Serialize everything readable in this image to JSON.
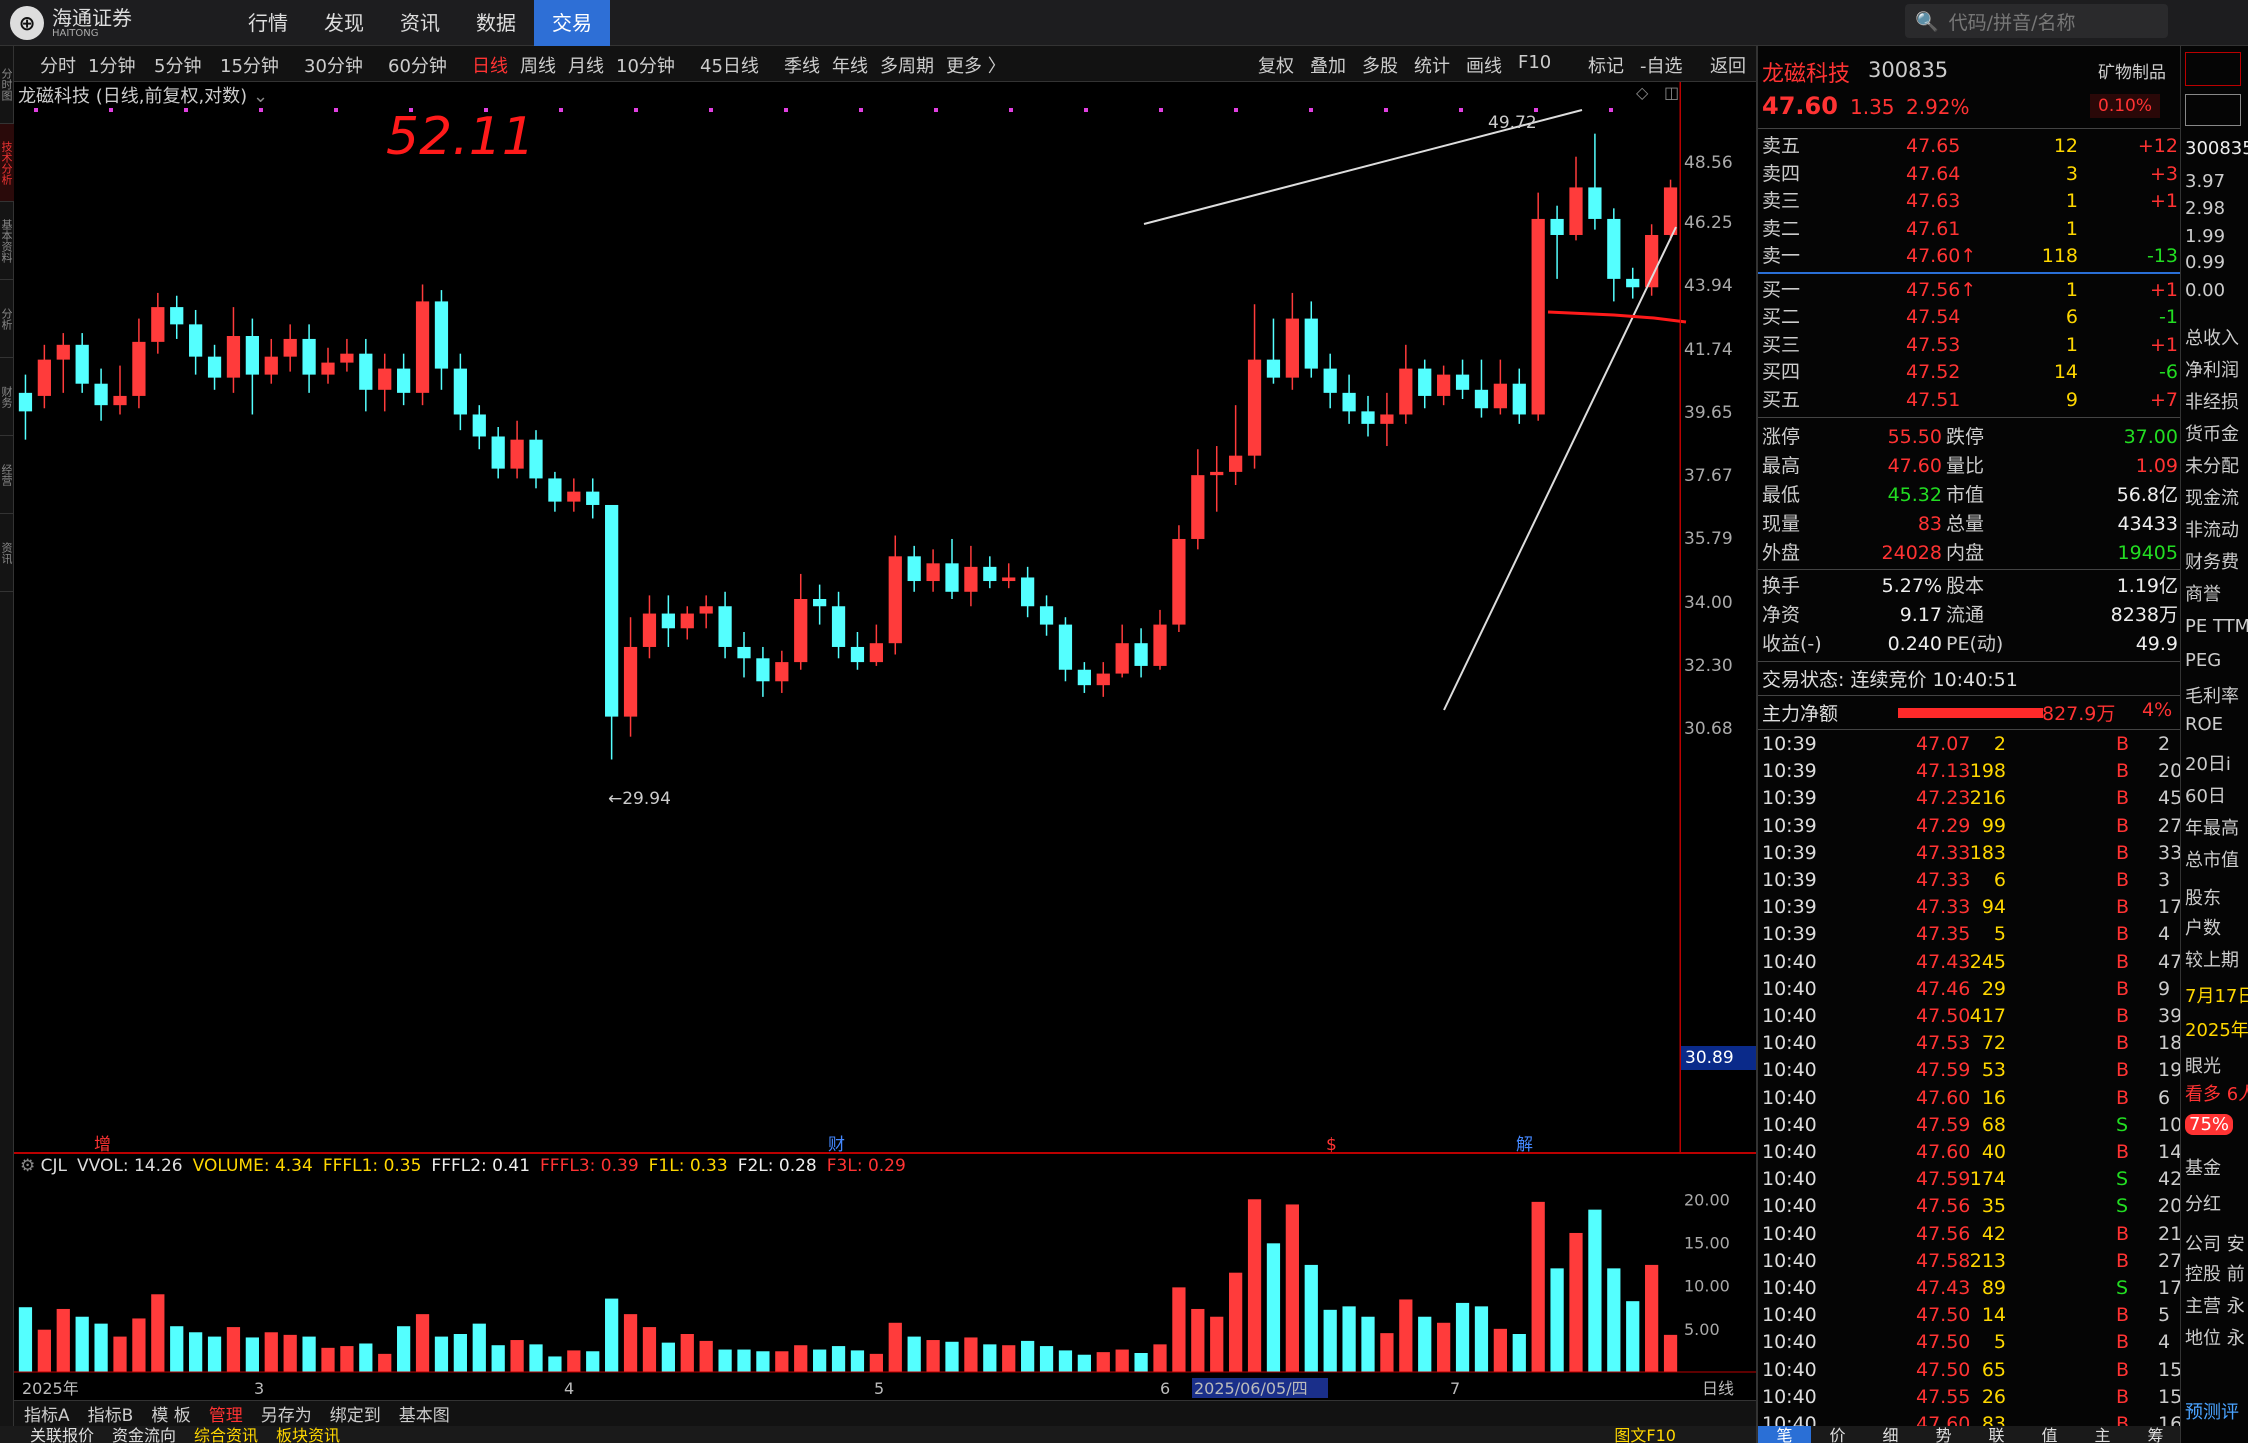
{
  "app": {
    "logo_text": "海通证券",
    "logo_sub": "HAITONG",
    "nav": [
      "行情",
      "发现",
      "资讯",
      "数据",
      "交易"
    ],
    "active_nav": "交易",
    "search_placeholder": "代码/拼音/名称"
  },
  "left_strip": [
    "分时图",
    "技术分析",
    "基本资料",
    "分析",
    "财务",
    "经营",
    "资讯"
  ],
  "period_bar": {
    "items": [
      "分时",
      "1分钟",
      "5分钟",
      "15分钟",
      "30分钟",
      "60分钟",
      "日线",
      "周线",
      "月线",
      "10分钟",
      "45日线",
      "季线",
      "年线",
      "多周期",
      "更多 〉"
    ],
    "active": "日线",
    "right_items": [
      "复权",
      "叠加",
      "多股",
      "统计",
      "画线",
      "F10",
      "标记",
      "-自选",
      "返回"
    ]
  },
  "chart": {
    "title": "龙磁科技 (日线,前复权,对数)",
    "annotation": "52.11",
    "high_label": "49.72",
    "low_label": "←29.94",
    "current_price": "30.89",
    "y_labels": [
      {
        "v": 48.56
      },
      {
        "v": 46.25
      },
      {
        "v": 43.94
      },
      {
        "v": 41.74
      },
      {
        "v": 39.65
      },
      {
        "v": 37.67
      },
      {
        "v": 35.79
      },
      {
        "v": 34.0
      },
      {
        "v": 32.3
      },
      {
        "v": 30.68
      }
    ],
    "event_marks": [
      "增",
      "财",
      "$",
      "解"
    ],
    "x_labels": [
      "2025年",
      "3",
      "4",
      "5",
      "6",
      "2025/06/05/四",
      "7"
    ],
    "indicator_line": [
      {
        "k": "CJL",
        "c": "#ddd"
      },
      {
        "k": "VVOL: 14.26",
        "c": "#ddd"
      },
      {
        "k": "VOLUME: 4.34",
        "c": "#ffd700"
      },
      {
        "k": "FFFL1: 0.35",
        "c": "#ffd700"
      },
      {
        "k": "FFFL2: 0.41",
        "c": "#eee"
      },
      {
        "k": "FFFL3: 0.39",
        "c": "#ff3333"
      },
      {
        "k": "F1L: 0.33",
        "c": "#ffd700"
      },
      {
        "k": "F2L: 0.28",
        "c": "#eee"
      },
      {
        "k": "F3L: 0.29",
        "c": "#ff3333"
      }
    ],
    "vol_labels": [
      "20.00",
      "15.00",
      "10.00",
      "5.00"
    ],
    "bottom_right": "日线"
  },
  "chart_data": {
    "type": "candlestick",
    "title": "龙磁科技 (日线,前复权,对数)",
    "candles": [
      [
        40.3,
        39.7,
        40.9,
        38.8
      ],
      [
        40.2,
        41.4,
        41.9,
        39.8
      ],
      [
        41.4,
        41.9,
        42.3,
        40.3
      ],
      [
        41.9,
        40.6,
        42.3,
        40.3
      ],
      [
        40.6,
        39.9,
        41.1,
        39.4
      ],
      [
        39.9,
        40.2,
        41.2,
        39.6
      ],
      [
        40.2,
        42.0,
        42.8,
        39.8
      ],
      [
        42.0,
        43.2,
        43.7,
        41.6
      ],
      [
        43.2,
        42.6,
        43.6,
        42.1
      ],
      [
        42.6,
        41.5,
        43.1,
        40.9
      ],
      [
        41.5,
        40.8,
        41.9,
        40.4
      ],
      [
        40.8,
        42.2,
        43.2,
        40.3
      ],
      [
        42.2,
        40.9,
        42.8,
        39.6
      ],
      [
        40.9,
        41.5,
        42.1,
        40.6
      ],
      [
        41.5,
        42.1,
        42.6,
        41.0
      ],
      [
        42.1,
        40.9,
        42.6,
        40.3
      ],
      [
        40.9,
        41.3,
        41.8,
        40.6
      ],
      [
        41.3,
        41.6,
        42.1,
        41.0
      ],
      [
        41.6,
        40.4,
        42.1,
        39.7
      ],
      [
        40.4,
        41.1,
        41.6,
        39.7
      ],
      [
        41.1,
        40.3,
        41.6,
        39.9
      ],
      [
        40.3,
        43.4,
        44.0,
        39.9
      ],
      [
        43.4,
        41.1,
        43.8,
        40.4
      ],
      [
        41.1,
        39.6,
        41.6,
        39.1
      ],
      [
        39.6,
        38.9,
        39.9,
        38.5
      ],
      [
        38.9,
        37.9,
        39.2,
        37.6
      ],
      [
        37.9,
        38.8,
        39.4,
        37.6
      ],
      [
        38.8,
        37.6,
        39.1,
        37.3
      ],
      [
        37.6,
        36.9,
        37.8,
        36.6
      ],
      [
        36.9,
        37.2,
        37.6,
        36.6
      ],
      [
        37.2,
        36.8,
        37.6,
        36.4
      ],
      [
        36.8,
        31.0,
        36.3,
        29.94
      ],
      [
        31.0,
        32.8,
        33.6,
        30.5
      ],
      [
        32.8,
        33.7,
        34.2,
        32.5
      ],
      [
        33.7,
        33.3,
        34.2,
        32.8
      ],
      [
        33.3,
        33.7,
        33.9,
        33.0
      ],
      [
        33.7,
        33.9,
        34.2,
        33.3
      ],
      [
        33.9,
        32.8,
        34.3,
        32.5
      ],
      [
        32.8,
        32.5,
        33.2,
        32.0
      ],
      [
        32.5,
        31.9,
        32.8,
        31.5
      ],
      [
        31.9,
        32.4,
        32.7,
        31.6
      ],
      [
        32.4,
        34.1,
        34.8,
        32.2
      ],
      [
        34.1,
        33.9,
        34.5,
        33.4
      ],
      [
        33.9,
        32.8,
        34.3,
        32.5
      ],
      [
        32.8,
        32.4,
        33.2,
        32.2
      ],
      [
        32.4,
        32.9,
        33.4,
        32.3
      ],
      [
        32.9,
        35.3,
        35.9,
        32.6
      ],
      [
        35.3,
        34.6,
        35.6,
        34.3
      ],
      [
        34.6,
        35.1,
        35.5,
        34.3
      ],
      [
        35.1,
        34.3,
        35.8,
        34.1
      ],
      [
        34.3,
        35.0,
        35.6,
        33.9
      ],
      [
        35.0,
        34.6,
        35.3,
        34.4
      ],
      [
        34.6,
        34.7,
        35.1,
        34.4
      ],
      [
        34.7,
        33.9,
        35.0,
        33.6
      ],
      [
        33.9,
        33.4,
        34.2,
        33.1
      ],
      [
        33.4,
        32.2,
        33.6,
        31.9
      ],
      [
        32.2,
        31.8,
        32.4,
        31.6
      ],
      [
        31.8,
        32.1,
        32.4,
        31.5
      ],
      [
        32.1,
        32.9,
        33.4,
        32.0
      ],
      [
        32.9,
        32.3,
        33.3,
        32.0
      ],
      [
        32.3,
        33.4,
        33.8,
        32.2
      ],
      [
        33.4,
        35.8,
        36.2,
        33.2
      ],
      [
        35.8,
        37.7,
        38.5,
        35.5
      ],
      [
        37.7,
        37.8,
        38.6,
        36.6
      ],
      [
        37.8,
        38.3,
        39.9,
        37.4
      ],
      [
        38.3,
        41.4,
        43.3,
        37.9
      ],
      [
        41.4,
        40.8,
        42.8,
        40.6
      ],
      [
        40.8,
        42.8,
        43.7,
        40.4
      ],
      [
        42.8,
        41.1,
        43.4,
        40.8
      ],
      [
        41.1,
        40.3,
        41.6,
        39.8
      ],
      [
        40.3,
        39.7,
        40.9,
        39.3
      ],
      [
        39.7,
        39.3,
        40.2,
        38.9
      ],
      [
        39.3,
        39.6,
        40.3,
        38.6
      ],
      [
        39.6,
        41.1,
        41.9,
        39.3
      ],
      [
        41.1,
        40.2,
        41.4,
        39.8
      ],
      [
        40.2,
        40.9,
        41.2,
        39.9
      ],
      [
        40.9,
        40.4,
        41.4,
        40.1
      ],
      [
        40.4,
        39.8,
        41.4,
        39.5
      ],
      [
        39.8,
        40.6,
        41.4,
        39.6
      ],
      [
        40.6,
        39.6,
        41.1,
        39.3
      ],
      [
        39.6,
        46.4,
        47.4,
        39.4
      ],
      [
        46.4,
        45.8,
        46.9,
        44.2
      ],
      [
        45.8,
        47.6,
        48.8,
        45.6
      ],
      [
        47.6,
        46.4,
        49.72,
        46.0
      ],
      [
        46.4,
        44.2,
        46.8,
        43.4
      ],
      [
        44.2,
        43.9,
        44.6,
        43.5
      ],
      [
        43.9,
        45.8,
        46.2,
        43.6
      ],
      [
        45.8,
        47.6,
        47.9,
        45.6
      ]
    ],
    "volume": [
      7.5,
      4.9,
      7.3,
      6.4,
      5.6,
      4.1,
      6.2,
      9.0,
      5.3,
      4.6,
      4.1,
      5.2,
      4.0,
      4.6,
      4.3,
      4.1,
      2.8,
      3.0,
      3.3,
      2.1,
      5.3,
      6.7,
      4.1,
      4.4,
      5.6,
      3.1,
      3.7,
      3.2,
      1.8,
      2.5,
      2.4,
      8.5,
      6.7,
      5.2,
      3.4,
      4.4,
      3.6,
      2.6,
      2.6,
      2.4,
      2.4,
      3.1,
      2.6,
      3.0,
      2.5,
      2.1,
      5.7,
      4.1,
      3.7,
      3.5,
      4.0,
      3.2,
      3.1,
      3.6,
      3.0,
      2.5,
      2.0,
      2.3,
      2.6,
      2.2,
      3.2,
      9.8,
      7.3,
      6.4,
      11.5,
      20.0,
      14.9,
      19.4,
      12.4,
      7.2,
      7.6,
      6.4,
      4.5,
      8.4,
      6.4,
      5.7,
      8.0,
      7.6,
      5.0,
      4.4,
      19.7,
      12.0,
      16.1,
      18.8,
      12.0,
      8.2,
      12.4,
      4.3
    ],
    "y_axis_labels": [
      48.56,
      46.25,
      43.94,
      41.74,
      39.65,
      37.67,
      35.79,
      34.0,
      32.3,
      30.68
    ],
    "x_axis_labels": [
      "2025年",
      "3",
      "4",
      "5",
      "6",
      "2025/06/05/四",
      "7"
    ],
    "high": 49.72,
    "low": 29.94
  },
  "quote": {
    "name": "龙磁科技",
    "code": "300835",
    "sector": "矿物制品",
    "sector_pct": "0.10%",
    "price": "47.60",
    "change": "1.35",
    "pct": "2.92%",
    "asks": [
      {
        "l": "卖五",
        "p": "47.65",
        "v": "12",
        "d": "+12"
      },
      {
        "l": "卖四",
        "p": "47.64",
        "v": "3",
        "d": "+3"
      },
      {
        "l": "卖三",
        "p": "47.63",
        "v": "1",
        "d": "+1"
      },
      {
        "l": "卖二",
        "p": "47.61",
        "v": "1",
        "d": ""
      },
      {
        "l": "卖一",
        "p": "47.60↑",
        "v": "118",
        "d": "-13"
      }
    ],
    "bids": [
      {
        "l": "买一",
        "p": "47.56↑",
        "v": "1",
        "d": "+1"
      },
      {
        "l": "买二",
        "p": "47.54",
        "v": "6",
        "d": "-1"
      },
      {
        "l": "买三",
        "p": "47.53",
        "v": "1",
        "d": "+1"
      },
      {
        "l": "买四",
        "p": "47.52",
        "v": "14",
        "d": "-6"
      },
      {
        "l": "买五",
        "p": "47.51",
        "v": "9",
        "d": "+7"
      }
    ],
    "stats": [
      [
        {
          "t": "涨停"
        },
        {
          "t": "55.50",
          "c": "red"
        },
        {
          "t": "跌停"
        },
        {
          "t": "37.00",
          "c": "green"
        }
      ],
      [
        {
          "t": "最高"
        },
        {
          "t": "47.60",
          "c": "red"
        },
        {
          "t": "量比"
        },
        {
          "t": "1.09",
          "c": "red"
        }
      ],
      [
        {
          "t": "最低"
        },
        {
          "t": "45.32",
          "c": "green"
        },
        {
          "t": "市值"
        },
        {
          "t": "56.8亿",
          "c": "white"
        }
      ],
      [
        {
          "t": "现量"
        },
        {
          "t": "83",
          "c": "red"
        },
        {
          "t": "总量"
        },
        {
          "t": "43433",
          "c": "white"
        }
      ],
      [
        {
          "t": "外盘"
        },
        {
          "t": "24028",
          "c": "red"
        },
        {
          "t": "内盘"
        },
        {
          "t": "19405",
          "c": "green"
        }
      ],
      [
        {
          "t": "换手"
        },
        {
          "t": "5.27%",
          "c": "white"
        },
        {
          "t": "股本"
        },
        {
          "t": "1.19亿",
          "c": "white"
        }
      ],
      [
        {
          "t": "净资"
        },
        {
          "t": "9.17",
          "c": "white"
        },
        {
          "t": "流通"
        },
        {
          "t": "8238万",
          "c": "white"
        }
      ],
      [
        {
          "t": "收益(-)"
        },
        {
          "t": "0.240",
          "c": "white"
        },
        {
          "t": "PE(动)"
        },
        {
          "t": "49.9",
          "c": "white"
        }
      ]
    ],
    "trade_state": "交易状态: 连续竞价 10:40:51",
    "main_flow": {
      "label": "主力净额",
      "value": "827.9万",
      "pct": "4%",
      "bar": 0.5
    },
    "ticks": [
      [
        "10:39",
        "47.07",
        "2",
        "B",
        "2"
      ],
      [
        "10:39",
        "47.13",
        "198",
        "B",
        "20"
      ],
      [
        "10:39",
        "47.23",
        "216",
        "B",
        "45"
      ],
      [
        "10:39",
        "47.29",
        "99",
        "B",
        "27"
      ],
      [
        "10:39",
        "47.33",
        "183",
        "B",
        "33"
      ],
      [
        "10:39",
        "47.33",
        "6",
        "B",
        "3"
      ],
      [
        "10:39",
        "47.33",
        "94",
        "B",
        "17"
      ],
      [
        "10:39",
        "47.35",
        "5",
        "B",
        "4"
      ],
      [
        "10:40",
        "47.43",
        "245",
        "B",
        "47"
      ],
      [
        "10:40",
        "47.46",
        "29",
        "B",
        "9"
      ],
      [
        "10:40",
        "47.50",
        "417",
        "B",
        "39"
      ],
      [
        "10:40",
        "47.53",
        "72",
        "B",
        "18"
      ],
      [
        "10:40",
        "47.59",
        "53",
        "B",
        "19"
      ],
      [
        "10:40",
        "47.60",
        "16",
        "B",
        "6"
      ],
      [
        "10:40",
        "47.59",
        "68",
        "S",
        "10"
      ],
      [
        "10:40",
        "47.60",
        "40",
        "B",
        "14"
      ],
      [
        "10:40",
        "47.59",
        "174",
        "S",
        "42"
      ],
      [
        "10:40",
        "47.56",
        "35",
        "S",
        "20"
      ],
      [
        "10:40",
        "47.56",
        "42",
        "B",
        "21"
      ],
      [
        "10:40",
        "47.58",
        "213",
        "B",
        "27"
      ],
      [
        "10:40",
        "47.43",
        "89",
        "S",
        "17"
      ],
      [
        "10:40",
        "47.50",
        "14",
        "B",
        "5"
      ],
      [
        "10:40",
        "47.50",
        "5",
        "B",
        "4"
      ],
      [
        "10:40",
        "47.50",
        "65",
        "B",
        "15"
      ],
      [
        "10:40",
        "47.55",
        "26",
        "B",
        "15"
      ],
      [
        "10:40",
        "47.60",
        "83",
        "B",
        "16"
      ]
    ],
    "panel_tabs": [
      "笔",
      "价",
      "细",
      "势",
      "联",
      "值",
      "主",
      "筹"
    ]
  },
  "far_right": {
    "items": [
      "300835",
      "3.97",
      "2.98",
      "1.99",
      "0.99",
      "0.00",
      "总收入",
      "净利润",
      "非经损",
      "货币金",
      "未分配",
      "现金流",
      "非流动",
      "财务费",
      "商誉",
      "PE TTM",
      "PEG",
      "毛利率",
      "ROE",
      "20日i",
      "60日",
      "年最高",
      "总市值",
      "股东",
      "户数",
      "较上期",
      "7月17日",
      "2025年",
      "眼光",
      "看多 6人",
      "75%",
      "基金",
      "分红",
      "公司 安",
      "控股 前",
      "主营 永",
      "地位 永",
      "预测评"
    ]
  },
  "bottom": {
    "tabs": [
      "指标A",
      "指标B",
      "模 板",
      "管理",
      "另存为",
      "绑定到",
      "基本图"
    ],
    "active_tab": "管理",
    "bar2": [
      "关联报价",
      "资金流向",
      "综合资讯",
      "板块资讯"
    ],
    "bar2_right": "图文F10"
  }
}
